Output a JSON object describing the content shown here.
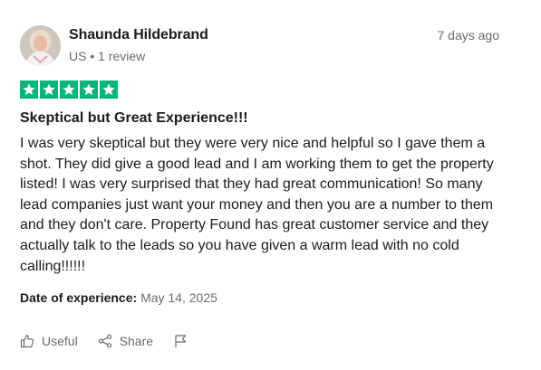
{
  "reviewer": {
    "name": "Shaunda Hildebrand",
    "country": "US",
    "separator": "•",
    "review_count": "1 review"
  },
  "review": {
    "date_ago": "7 days ago",
    "rating": 5,
    "rating_color": "#00b67a",
    "title": "Skeptical but Great Experience!!!",
    "body": "I was very skeptical but they were very nice and helpful so I gave them a shot. They did give a good lead and I am working them to get the property listed! I was very surprised that they had great communication! So many lead companies just want your money and then you are a number to them and they don't care. Property Found has great customer service and they actually talk to the leads so you have given a warm lead with no cold calling!!!!!!",
    "experience_label": "Date of experience:",
    "experience_date": "May 14, 2025"
  },
  "actions": {
    "useful_label": "Useful",
    "useful_icon": "thumbs-up-icon",
    "share_label": "Share",
    "share_icon": "share-icon",
    "report_icon": "flag-icon"
  }
}
